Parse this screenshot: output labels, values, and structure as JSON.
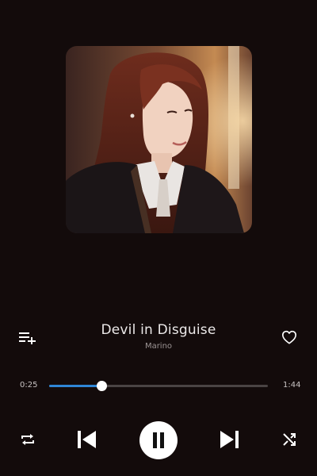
{
  "track": {
    "title": "Devil in Disguise",
    "artist": "Marino"
  },
  "progress": {
    "elapsed": "0:25",
    "total": "1:44",
    "fraction": 0.24
  },
  "colors": {
    "background": "#130b0b",
    "accent": "#2f86d6",
    "knob": "#ffffff"
  },
  "icons": {
    "add_to_queue": "playlist-add-icon",
    "favorite": "heart-outline-icon",
    "repeat": "repeat-icon",
    "previous": "skip-previous-icon",
    "play_pause": "pause-icon",
    "next": "skip-next-icon",
    "shuffle": "shuffle-icon"
  }
}
